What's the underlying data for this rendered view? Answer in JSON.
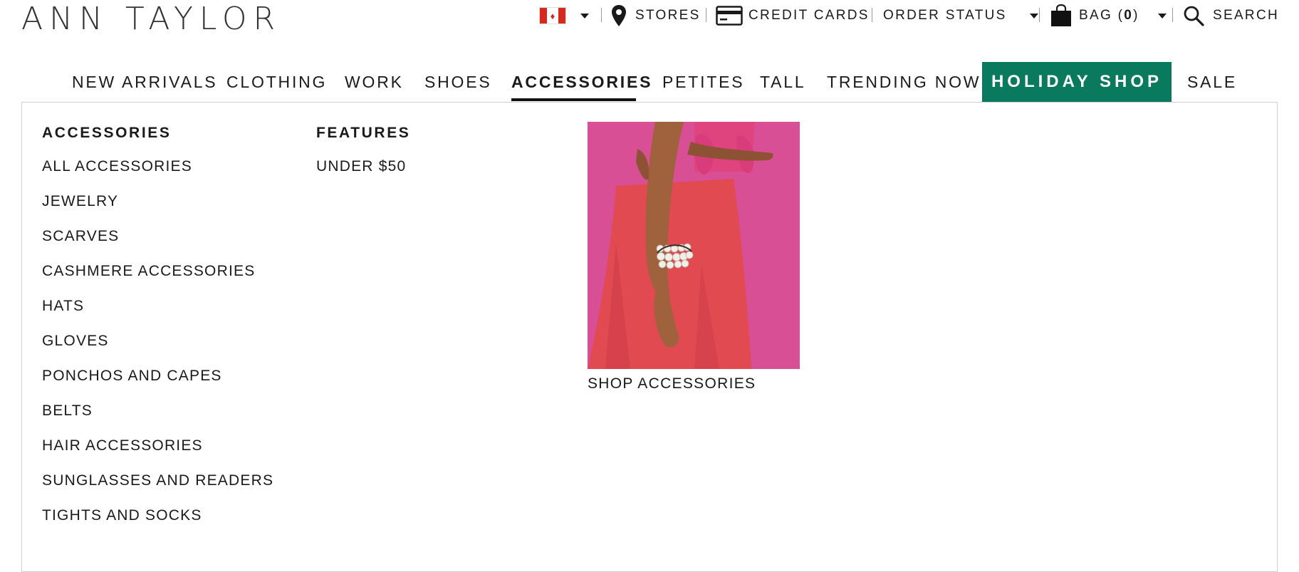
{
  "brand": {
    "logo": "ANN TAYLOR"
  },
  "utility": {
    "country": "Canada",
    "stores": "STORES",
    "credit_cards": "CREDIT CARDS",
    "order_status": "ORDER STATUS",
    "bag_label": "BAG (",
    "bag_count": "0",
    "bag_close": ")",
    "search": "SEARCH",
    "icons": {
      "location": "location-pin-icon",
      "card": "credit-card-icon",
      "bag": "shopping-bag-icon",
      "search": "search-icon"
    }
  },
  "nav": {
    "items": [
      "NEW ARRIVALS",
      "CLOTHING",
      "WORK",
      "SHOES",
      "ACCESSORIES",
      "PETITES",
      "TALL",
      "TRENDING NOW",
      "HOLIDAY SHOP",
      "SALE"
    ],
    "active": "ACCESSORIES",
    "highlight_color": "#0a7a5e"
  },
  "menu": {
    "accessories": {
      "heading": "ACCESSORIES",
      "items": [
        "ALL ACCESSORIES",
        "JEWELRY",
        "SCARVES",
        "CASHMERE ACCESSORIES",
        "HATS",
        "GLOVES",
        "PONCHOS AND CAPES",
        "BELTS",
        "HAIR ACCESSORIES",
        "SUNGLASSES AND READERS",
        "TIGHTS AND SOCKS"
      ]
    },
    "features": {
      "heading": "FEATURES",
      "items": [
        "UNDER $50"
      ]
    },
    "promo": {
      "caption": "SHOP ACCESSORIES"
    }
  }
}
